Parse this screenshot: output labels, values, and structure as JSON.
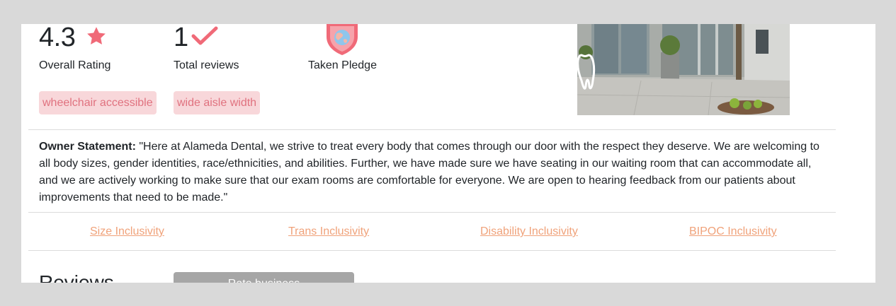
{
  "stats": {
    "rating": {
      "value": "4.3",
      "label": "Overall Rating",
      "icon": "star-icon"
    },
    "reviews": {
      "value": "1",
      "label": "Total reviews",
      "icon": "check-icon"
    },
    "pledge": {
      "label": "Taken Pledge",
      "icon": "pledge-shield-icon"
    }
  },
  "tags": [
    "wheelchair accessible",
    "wide aisle width"
  ],
  "owner_statement": {
    "label": "Owner Statement:",
    "text": "\"Here at Alameda Dental, we strive to treat every body that comes through our door with the respect they deserve. We are welcoming to all body sizes, gender identities, race/ethnicities, and abilities. Further, we have made sure we have seating in our waiting room that can accommodate all, and we are actively working to make sure that our exam rooms are comfortable for everyone. We are open to hearing feedback from our patients about improvements that need to be made.\""
  },
  "inclusivity_links": [
    "Size Inclusivity",
    "Trans Inclusivity",
    "Disability Inclusivity",
    "BIPOC Inclusivity"
  ],
  "reviews_section": {
    "title": "Reviews",
    "button_label": "Rate business"
  },
  "colors": {
    "accent": "#f06a78",
    "tag_bg": "#f8d7da",
    "tag_text": "#e0727f",
    "link": "#f0a27a",
    "button_bg": "#a6a6a6"
  }
}
